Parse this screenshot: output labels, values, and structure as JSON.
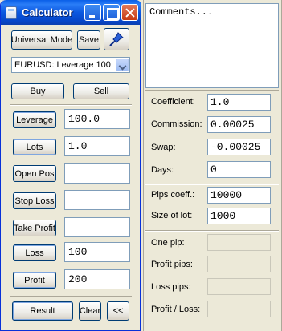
{
  "window": {
    "title": "Calculator",
    "minimize_icon": "minimize-icon",
    "maximize_icon": "maximize-icon",
    "close_icon": "close-icon"
  },
  "toolbar": {
    "mode_button": "Universal Mode",
    "save_button": "Save",
    "pin_icon": "pin-icon"
  },
  "symbol_select": {
    "value": "EURUSD: Leverage 100"
  },
  "trade": {
    "buy": "Buy",
    "sell": "Sell"
  },
  "rows": [
    {
      "button": "Leverage",
      "value": "100.0"
    },
    {
      "button": "Lots",
      "value": "1.0"
    },
    {
      "button": "Open Pos",
      "value": ""
    },
    {
      "button": "Stop Loss",
      "value": ""
    },
    {
      "button": "Take Profit",
      "value": ""
    },
    {
      "button": "Loss",
      "value": "100"
    },
    {
      "button": "Profit",
      "value": "200"
    }
  ],
  "bottom": {
    "result": "Result",
    "clear": "Clear",
    "toggle": "<<"
  },
  "comments": {
    "value": "Comments..."
  },
  "right_fields": [
    {
      "label": "Coefficient:",
      "value": "1.0"
    },
    {
      "label": "Commission:",
      "value": "0.00025"
    },
    {
      "label": "Swap:",
      "value": "-0.00025"
    },
    {
      "label": "Days:",
      "value": "0"
    },
    {
      "label": "Pips coeff.:",
      "value": "10000"
    },
    {
      "label": "Size of lot:",
      "value": "1000"
    },
    {
      "label": "One pip:",
      "value": ""
    },
    {
      "label": "Profit pips:",
      "value": ""
    },
    {
      "label": "Loss pips:",
      "value": ""
    },
    {
      "label": "Profit / Loss:",
      "value": ""
    }
  ]
}
